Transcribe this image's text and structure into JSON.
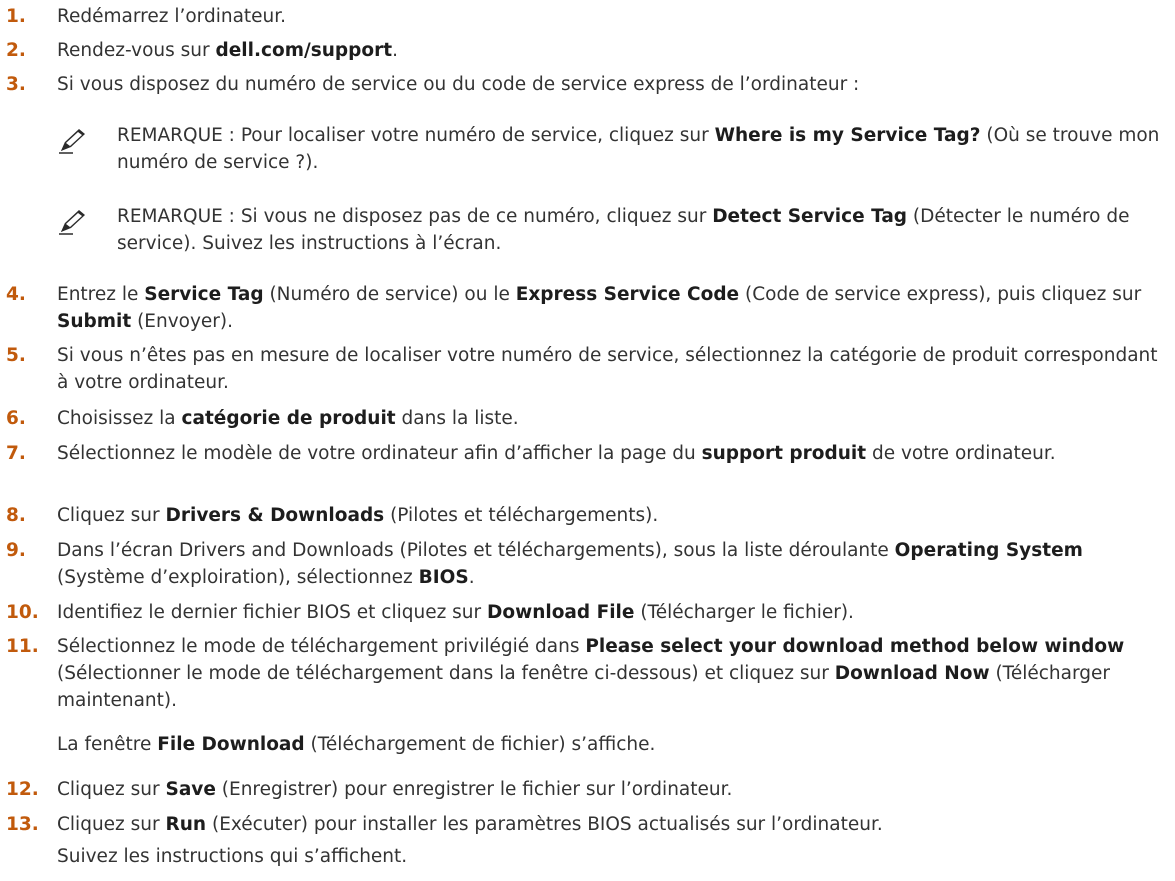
{
  "steps": [
    {
      "num": "1.",
      "text": "Redémarrez l’ordinateur."
    },
    {
      "num": "2.",
      "a": "Rendez-vous sur ",
      "b1": "dell.com/support",
      "c": "."
    },
    {
      "num": "3.",
      "text": "Si vous disposez du numéro de service ou du code de service express de l’ordinateur :"
    },
    {
      "num": "4.",
      "a": "Entrez le ",
      "b1": "Service Tag",
      "c": " (Numéro de service) ou le ",
      "b2": "Express Service Code",
      "d": " (Code de service express), puis cliquez sur ",
      "b3": "Submit",
      "e": " (Envoyer)."
    },
    {
      "num": "5.",
      "text": "Si vous n’êtes pas en mesure de localiser votre numéro de service, sélectionnez la catégorie de produit correspondant à votre ordinateur."
    },
    {
      "num": "6.",
      "a": "Choisissez la ",
      "b1": "catégorie de produit",
      "c": " dans la liste."
    },
    {
      "num": "7.",
      "a": "Sélectionnez le modèle de votre ordinateur afin d’afficher la page du ",
      "b1": "support produit",
      "c": " de votre ordinateur."
    },
    {
      "num": "8.",
      "a": "Cliquez sur ",
      "b1": "Drivers & Downloads",
      "c": " (Pilotes et téléchargements)."
    },
    {
      "num": "9.",
      "a": "Dans l’écran Drivers and Downloads (Pilotes et téléchargements), sous la liste déroulante ",
      "b1": "Operating System",
      "c": " (Système d’exploiration), sélectionnez ",
      "b2": "BIOS",
      "d": "."
    },
    {
      "num": "10.",
      "a": "Identifiez le dernier fichier BIOS et cliquez sur ",
      "b1": "Download File",
      "c": " (Télécharger le fichier)."
    },
    {
      "num": "11.",
      "a": "Sélectionnez le mode de téléchargement privilégié dans ",
      "b1": "Please select your download method below window",
      "c": " (Sélectionner le mode de téléchargement dans la fenêtre ci-dessous) et cliquez sur ",
      "b2": "Download Now",
      "d": " (Télécharger maintenant)."
    },
    {
      "num": "12.",
      "a": "Cliquez sur ",
      "b1": "Save",
      "c": " (Enregistrer) pour enregistrer le fichier sur l’ordinateur."
    },
    {
      "num": "13.",
      "a": "Cliquez sur ",
      "b1": "Run",
      "c": " (Exécuter) pour installer les paramètres BIOS actualisés sur l’ordinateur."
    }
  ],
  "notes": [
    {
      "label": "REMARQUE : ",
      "a": "Pour localiser votre numéro de service, cliquez sur ",
      "b1": "Where is my Service Tag?",
      "c": " (Où se trouve mon numéro de service ?)."
    },
    {
      "label": "REMARQUE : ",
      "a": "Si vous ne disposez pas de ce numéro, cliquez sur ",
      "b1": "Detect Service Tag",
      "c": " (Détecter le numéro de service). Suivez les instructions à l’écran."
    }
  ],
  "sub11": {
    "a": "La fenêtre ",
    "b1": "File Download",
    "c": " (Téléchargement de fichier) s’affiche."
  },
  "sub13": {
    "text": "Suivez les instructions qui s’affichent."
  }
}
